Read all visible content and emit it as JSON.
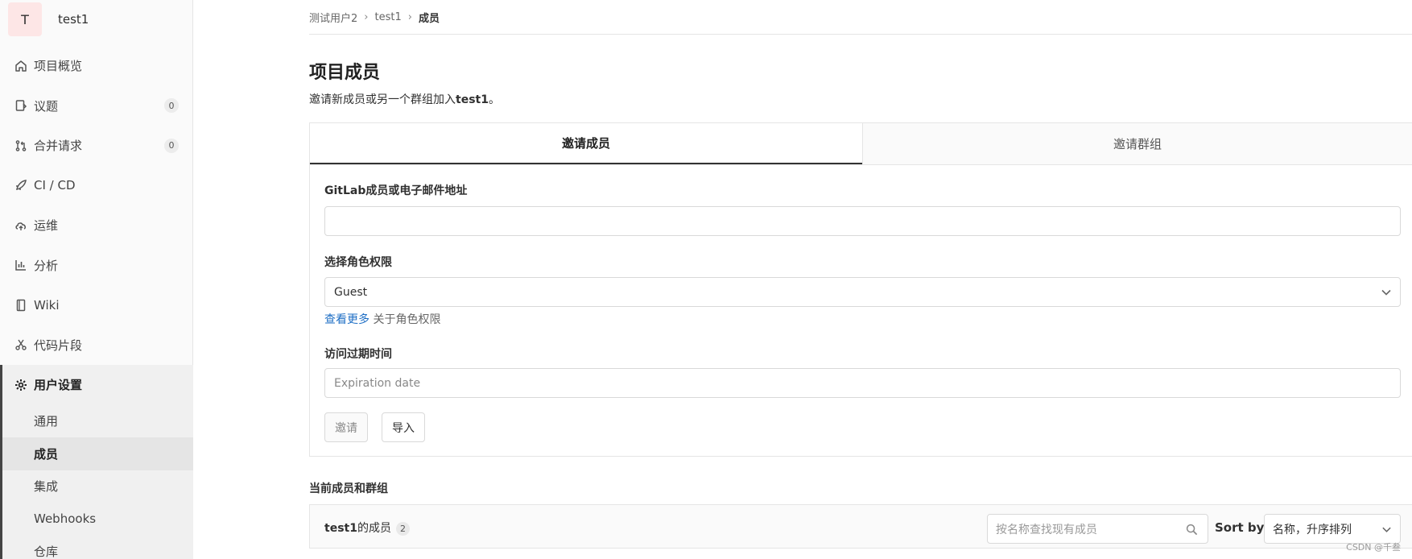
{
  "project": {
    "avatar_letter": "T",
    "name": "test1"
  },
  "sidebar": {
    "items": [
      {
        "label": "项目概览",
        "icon": "home-icon"
      },
      {
        "label": "议题",
        "icon": "issues-icon",
        "count": "0"
      },
      {
        "label": "合并请求",
        "icon": "merge-request-icon",
        "count": "0"
      },
      {
        "label": "CI / CD",
        "icon": "rocket-icon"
      },
      {
        "label": "运维",
        "icon": "cloud-icon"
      },
      {
        "label": "分析",
        "icon": "chart-icon"
      },
      {
        "label": "Wiki",
        "icon": "book-icon"
      },
      {
        "label": "代码片段",
        "icon": "scissors-icon"
      }
    ],
    "settings": {
      "label": "用户设置",
      "icon": "gear-icon",
      "sub_items": [
        "通用",
        "成员",
        "集成",
        "Webhooks",
        "仓库"
      ],
      "active_sub": "成员"
    }
  },
  "breadcrumb": [
    "测试用户2",
    "test1",
    "成员"
  ],
  "page": {
    "title": "项目成员",
    "desc_prefix": "邀请新成员或另一个群组加入",
    "desc_project": "test1",
    "desc_suffix": "。"
  },
  "tabs": {
    "invite_member": "邀请成员",
    "invite_group": "邀请群组"
  },
  "form": {
    "member_label": "GitLab成员或电子邮件地址",
    "member_value": "",
    "role_label": "选择角色权限",
    "role_value": "Guest",
    "help_link": "查看更多",
    "help_text": " 关于角色权限",
    "expiry_label": "访问过期时间",
    "expiry_placeholder": "Expiration date",
    "invite_button": "邀请",
    "import_button": "导入"
  },
  "members": {
    "section_title": "当前成员和群组",
    "title_project": "test1",
    "title_suffix": "的成员",
    "count": "2",
    "search_placeholder": "按名称查找现有成员",
    "sort_label": "Sort by",
    "sort_value": "名称，升序排列"
  },
  "watermark": "CSDN @千叁",
  "colors": {
    "accent": "#1f6fc5",
    "badge_green": "#1aaa55",
    "avatar_bg": "#fde6e6"
  }
}
